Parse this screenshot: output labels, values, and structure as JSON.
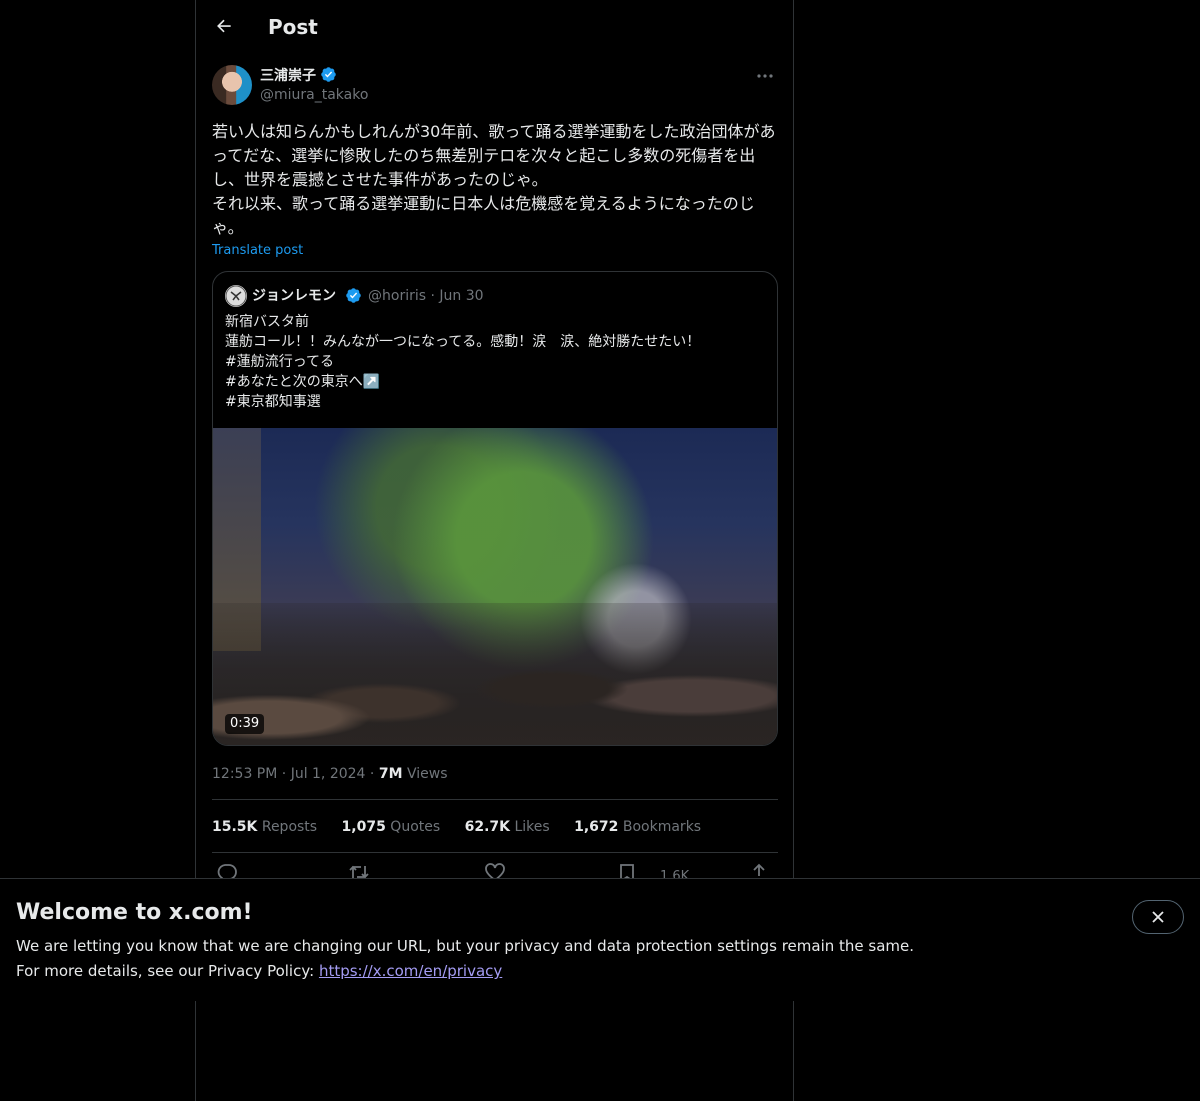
{
  "header": {
    "title": "Post",
    "back_icon": "arrow-left-icon"
  },
  "tweet": {
    "author_name": "三浦崇子",
    "author_handle": "@miura_takako",
    "text": "若い人は知らんかもしれんが30年前、歌って踊る選挙運動をした政治団体があってだな、選挙に惨敗したのち無差別テロを次々と起こし多数の死傷者を出し、世界を震撼とさせた事件があったのじゃ。\nそれ以来、歌って踊る選挙運動に日本人は危機感を覚えるようになったのじゃ。",
    "translate_label": "Translate post",
    "time": "12:53 PM",
    "date": "Jul 1, 2024",
    "views_count": "7M",
    "views_label": "Views",
    "sep": "·"
  },
  "quote": {
    "author_name": "ジョンレモン",
    "author_handle": "@horiris",
    "date": "Jun 30",
    "sep": "·",
    "text": "新宿バスタ前\n蓮舫コール！！みんなが一つになってる。感動！涙　涙、絶対勝たせたい！\n#蓮舫流行ってる\n#あなたと次の東京へ↗️\n#東京都知事選",
    "video_duration": "0:39"
  },
  "stats": {
    "reposts_count": "15.5K",
    "reposts_label": "Reposts",
    "quotes_count": "1,075",
    "quotes_label": "Quotes",
    "likes_count": "62.7K",
    "likes_label": "Likes",
    "bookmarks_count": "1,672",
    "bookmarks_label": "Bookmarks"
  },
  "actions": {
    "bookmark_count": "1.6K"
  },
  "banner": {
    "title": "Welcome to x.com!",
    "line1": "We are letting you know that we are changing our URL, but your privacy and data protection settings remain the same.",
    "line2_prefix": "For more details, see our Privacy Policy: ",
    "link": "https://x.com/en/privacy"
  },
  "colors": {
    "accent": "#1d9bf0",
    "link_purple": "#a49cf3",
    "border": "#2f3336",
    "muted": "#71767b"
  }
}
